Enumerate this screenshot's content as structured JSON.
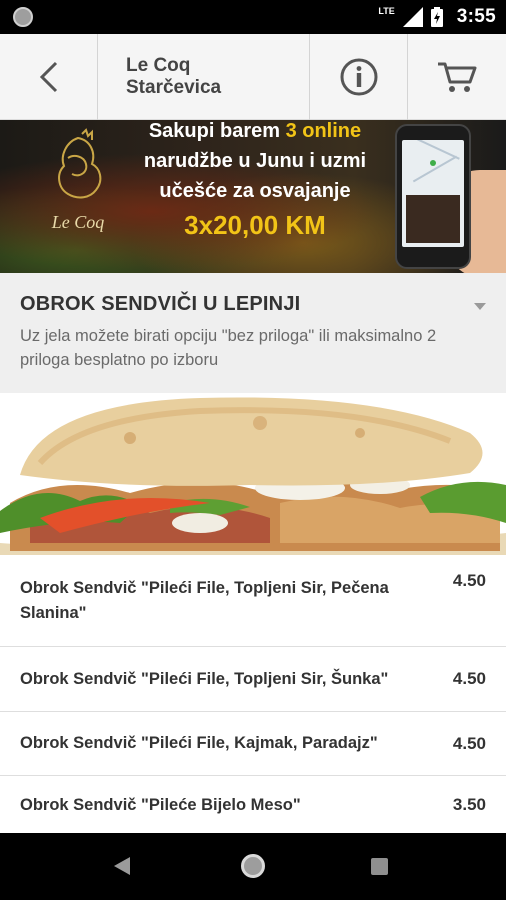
{
  "status_bar": {
    "network": "LTE",
    "time": "3:55",
    "icons": [
      "notification-dot-icon",
      "signal-icon",
      "battery-icon"
    ]
  },
  "app_bar": {
    "title_line1": "Le Coq",
    "title_line2": "Starčevica",
    "icons": [
      "back-arrow-icon",
      "info-icon",
      "cart-icon"
    ]
  },
  "banner": {
    "logo_text": "Le Coq",
    "line1_pre": "Sakupi barem ",
    "line1_highlight": "3 online",
    "line2": "narudžbe u Junu i uzmi",
    "line3": "učešće za osvajanje",
    "prize": "3x20,00 KM"
  },
  "section": {
    "title": "OBROK SENDVIČI U LEPINJI",
    "description": "Uz jela možete birati opciju \"bez priloga\" ili maksimalno 2 priloga besplatno po izboru"
  },
  "menu_items": [
    {
      "name": "Obrok Sendvič \"Pileći File, Topljeni Sir, Pečena Slanina\"",
      "price": "4.50"
    },
    {
      "name": "Obrok Sendvič \"Pileći File, Topljeni Sir, Šunka\"",
      "price": "4.50"
    },
    {
      "name": "Obrok Sendvič \"Pileći File, Kajmak, Paradajz\"",
      "price": "4.50"
    },
    {
      "name": "Obrok Sendvič \"Pileće Bijelo Meso\"",
      "price": "3.50"
    }
  ],
  "colors": {
    "accent_yellow": "#f2c417",
    "app_bar_bg": "#f5f5f5",
    "section_bg": "#efefef"
  }
}
